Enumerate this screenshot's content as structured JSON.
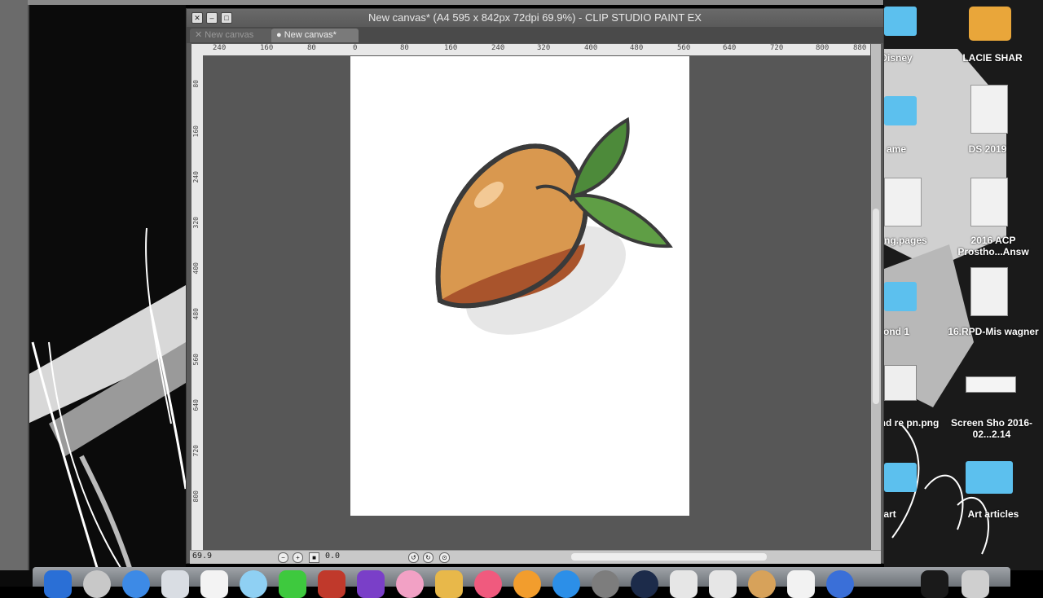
{
  "window": {
    "title": "New canvas* (A4 595 x 842px 72dpi 69.9%)  - CLIP STUDIO PAINT EX",
    "tabs": [
      {
        "label": "New canvas",
        "active": false
      },
      {
        "label": "New canvas*",
        "active": true
      }
    ]
  },
  "rulers": {
    "horizontal": [
      "240",
      "160",
      "80",
      "0",
      "80",
      "160",
      "240",
      "320",
      "400",
      "480",
      "560",
      "640",
      "720",
      "800",
      "880"
    ],
    "vertical": [
      "80",
      "160",
      "240",
      "320",
      "400",
      "480",
      "560",
      "640",
      "720",
      "800"
    ]
  },
  "statusbar": {
    "zoom": "69.9",
    "angle": "0.0"
  },
  "desktop": {
    "items": [
      {
        "label": "Disney",
        "icon": "folder-icon"
      },
      {
        "label": "LACIE SHAR",
        "icon": "drive-icon"
      },
      {
        "label": "ame",
        "icon": "folder-icon"
      },
      {
        "label": "DS 2019",
        "icon": "document-icon"
      },
      {
        "label": "ang.pages",
        "icon": "document-icon"
      },
      {
        "label": "2016 ACP Prostho...Answ",
        "icon": "document-icon"
      },
      {
        "label": "ond 1",
        "icon": "folder-icon"
      },
      {
        "label": "16.RPD-Mis wagner",
        "icon": "document-icon"
      },
      {
        "label": "Brand re pn.png",
        "icon": "image-icon"
      },
      {
        "label": "Screen Sho 2016-02...2.14",
        "icon": "image-icon"
      },
      {
        "label": "art",
        "icon": "folder-icon"
      },
      {
        "label": "Art articles",
        "icon": "folder-icon"
      }
    ]
  },
  "colors": {
    "accent": "#5cc0ee",
    "canvas_bg": "#575757",
    "fruit_light": "#d9984f",
    "fruit_dark": "#a9542c",
    "leaf": "#4d8a3a"
  }
}
